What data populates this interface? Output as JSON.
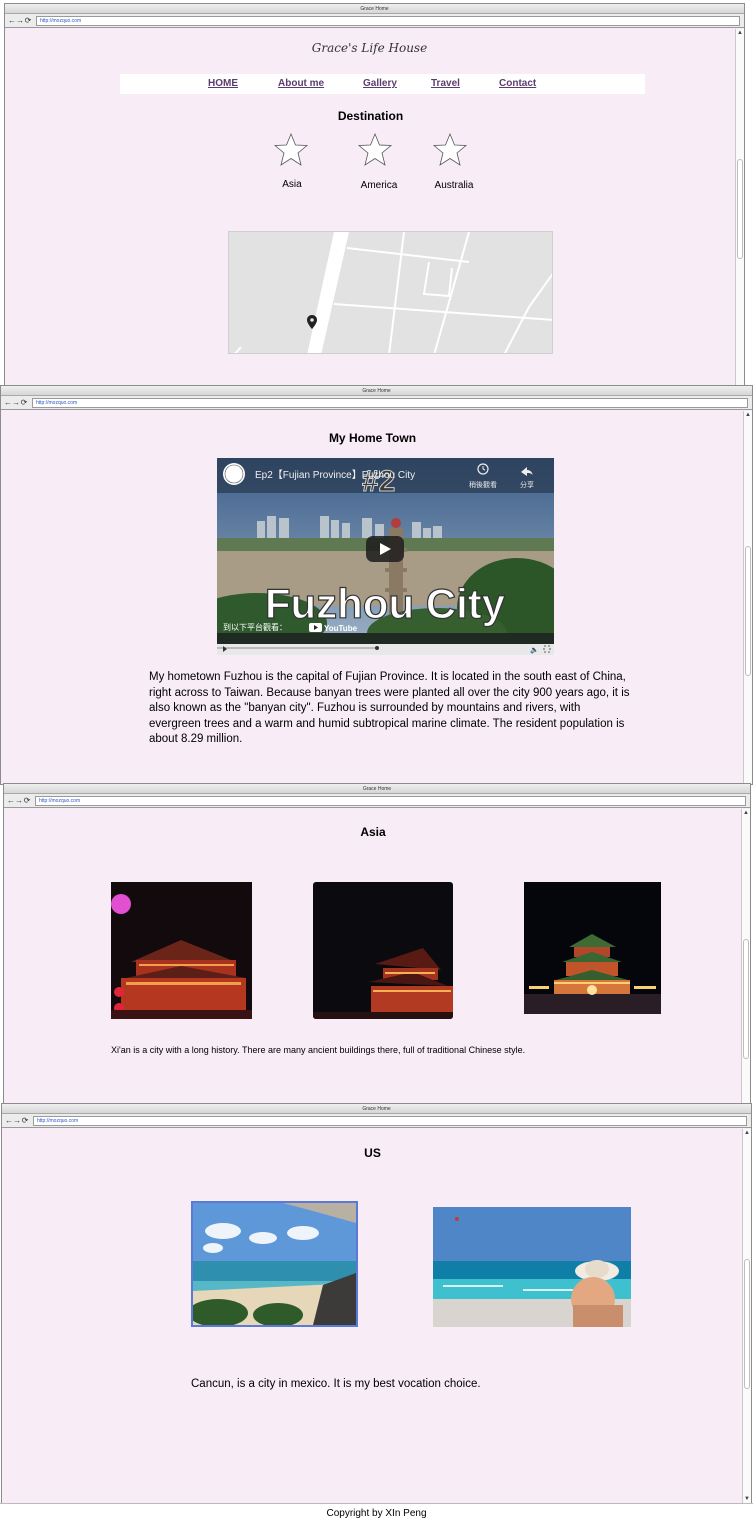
{
  "browser": {
    "window_title": "Grace Home",
    "url": "http://mozquo.com"
  },
  "brand": {
    "name": "Grace's Life House"
  },
  "nav": {
    "items": [
      "HOME",
      "About me",
      "Gallery",
      "Travel",
      "Contact"
    ]
  },
  "destination": {
    "title": "Destination",
    "items": [
      "Asia",
      "America",
      "Australia"
    ]
  },
  "hometown": {
    "title": "My Home Town",
    "video": {
      "title": "Ep2【Fujian Province】Fuzhou City",
      "episode": "#2",
      "overlay": "Fuzhou City",
      "watch_later": "稍後觀看",
      "share": "分享",
      "watch_on": "到以下平台觀看：",
      "platform": "YouTube"
    },
    "text": "My hometown Fuzhou is the capital of Fujian Province. It is located in the south east of China, right across to Taiwan. Because banyan trees were planted all over the city 900 years ago, it is also known as the \"banyan city\". Fuzhou is surrounded by mountains and rivers, with evergreen trees and a warm and humid subtropical marine climate. The resident population is about 8.29 million."
  },
  "asia": {
    "title": "Asia",
    "text": "Xi'an is a city with a long history. There are many ancient buildings there, full of traditional Chinese style."
  },
  "us": {
    "title": "US",
    "text": "Cancun, is a city in mexico. It is my best vocation choice."
  },
  "footer": {
    "text": "Copyright by XIn Peng"
  },
  "colors": {
    "page_bg": "#f8ecf6",
    "nav_link": "#5a3d6e",
    "url": "#2a58c8"
  }
}
